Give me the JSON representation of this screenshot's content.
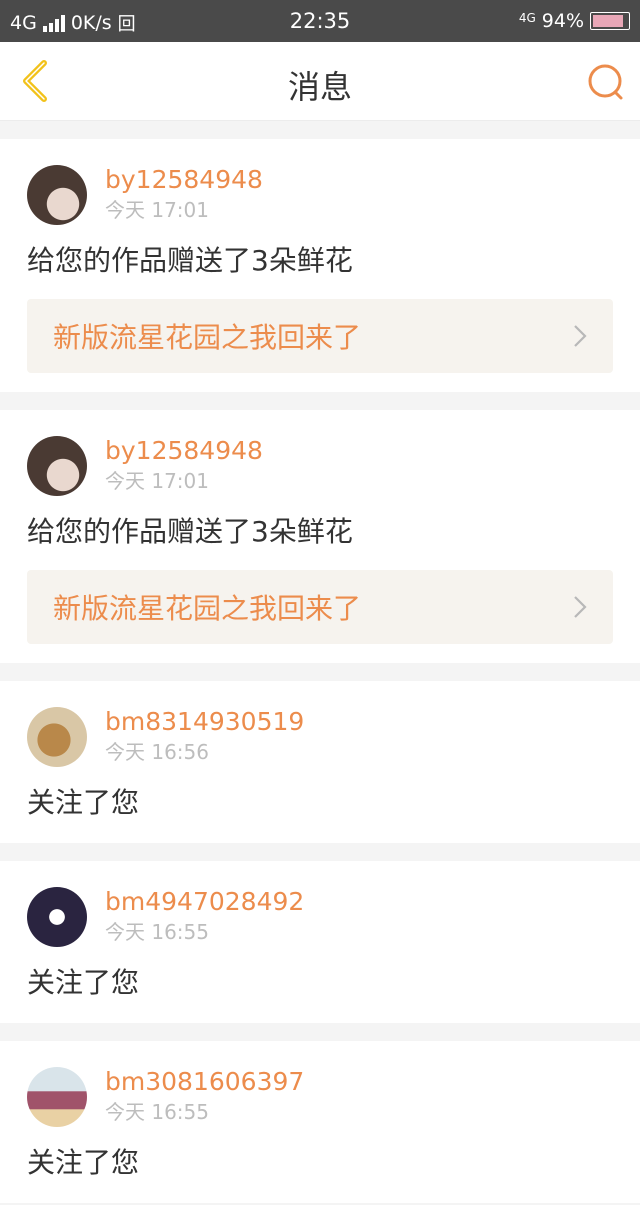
{
  "status_bar": {
    "network": "4G",
    "speed": "0K/s",
    "sim_glyph": "回",
    "time": "22:35",
    "network_right": "4G",
    "battery": "94%"
  },
  "header": {
    "title": "消息",
    "back_icon": "chevron-left-icon",
    "search_icon": "search-icon"
  },
  "colors": {
    "accent": "#ec8c4c",
    "back_icon": "#f2c21a",
    "work_bg": "#f6f3ee"
  },
  "messages": [
    {
      "username": "by12584948",
      "time": "今天 17:01",
      "action": "给您的作品赠送了3朵鲜花",
      "work_title": "新版流星花园之我回来了"
    },
    {
      "username": "by12584948",
      "time": "今天 17:01",
      "action": "给您的作品赠送了3朵鲜花",
      "work_title": "新版流星花园之我回来了"
    },
    {
      "username": "bm8314930519",
      "time": "今天 16:56",
      "action": "关注了您"
    },
    {
      "username": "bm4947028492",
      "time": "今天 16:55",
      "action": "关注了您"
    },
    {
      "username": "bm3081606397",
      "time": "今天 16:55",
      "action": "关注了您"
    }
  ]
}
